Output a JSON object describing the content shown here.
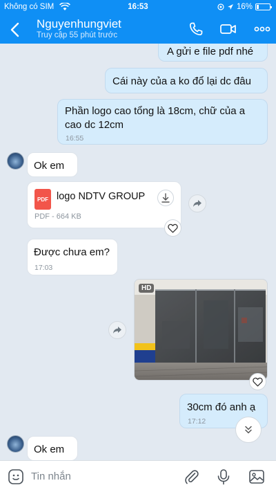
{
  "status_bar": {
    "carrier": "Không có SIM",
    "time": "16:53",
    "battery": "16%",
    "battery_level": 0.16
  },
  "header": {
    "title": "Nguyenhungviet",
    "subtitle": "Truy cập 55 phút trước",
    "bg_color": "#0f8ff5"
  },
  "messages": {
    "m1": {
      "text": "A gửi e file pdf nhé"
    },
    "m2": {
      "text": "Cái này của a ko đổ lại dc đâu"
    },
    "m3": {
      "line1": "Phần logo cao tổng là 18cm, chữ của a",
      "line2": "cao dc 12cm",
      "time": "16:55"
    },
    "m4": {
      "text": "Ok em"
    },
    "file": {
      "name": "logo NDTV GROUP",
      "meta": "PDF - 664 KB",
      "icon_label": "PDF"
    },
    "m5": {
      "text": "Được chưa em?",
      "time": "17:03"
    },
    "photo": {
      "badge": "HD"
    },
    "m6": {
      "text": "30cm đó anh ạ",
      "time": "17:12"
    },
    "m7": {
      "text": "Ok em"
    }
  },
  "composer": {
    "placeholder": "Tin nhắn"
  },
  "icons": [
    "back-icon",
    "phone-icon",
    "video-call-icon",
    "more-icon",
    "pdf-file-icon",
    "download-icon",
    "share-icon",
    "heart-icon",
    "chevron-double-down-icon",
    "sticker-icon",
    "attachment-icon",
    "microphone-icon",
    "image-icon"
  ]
}
